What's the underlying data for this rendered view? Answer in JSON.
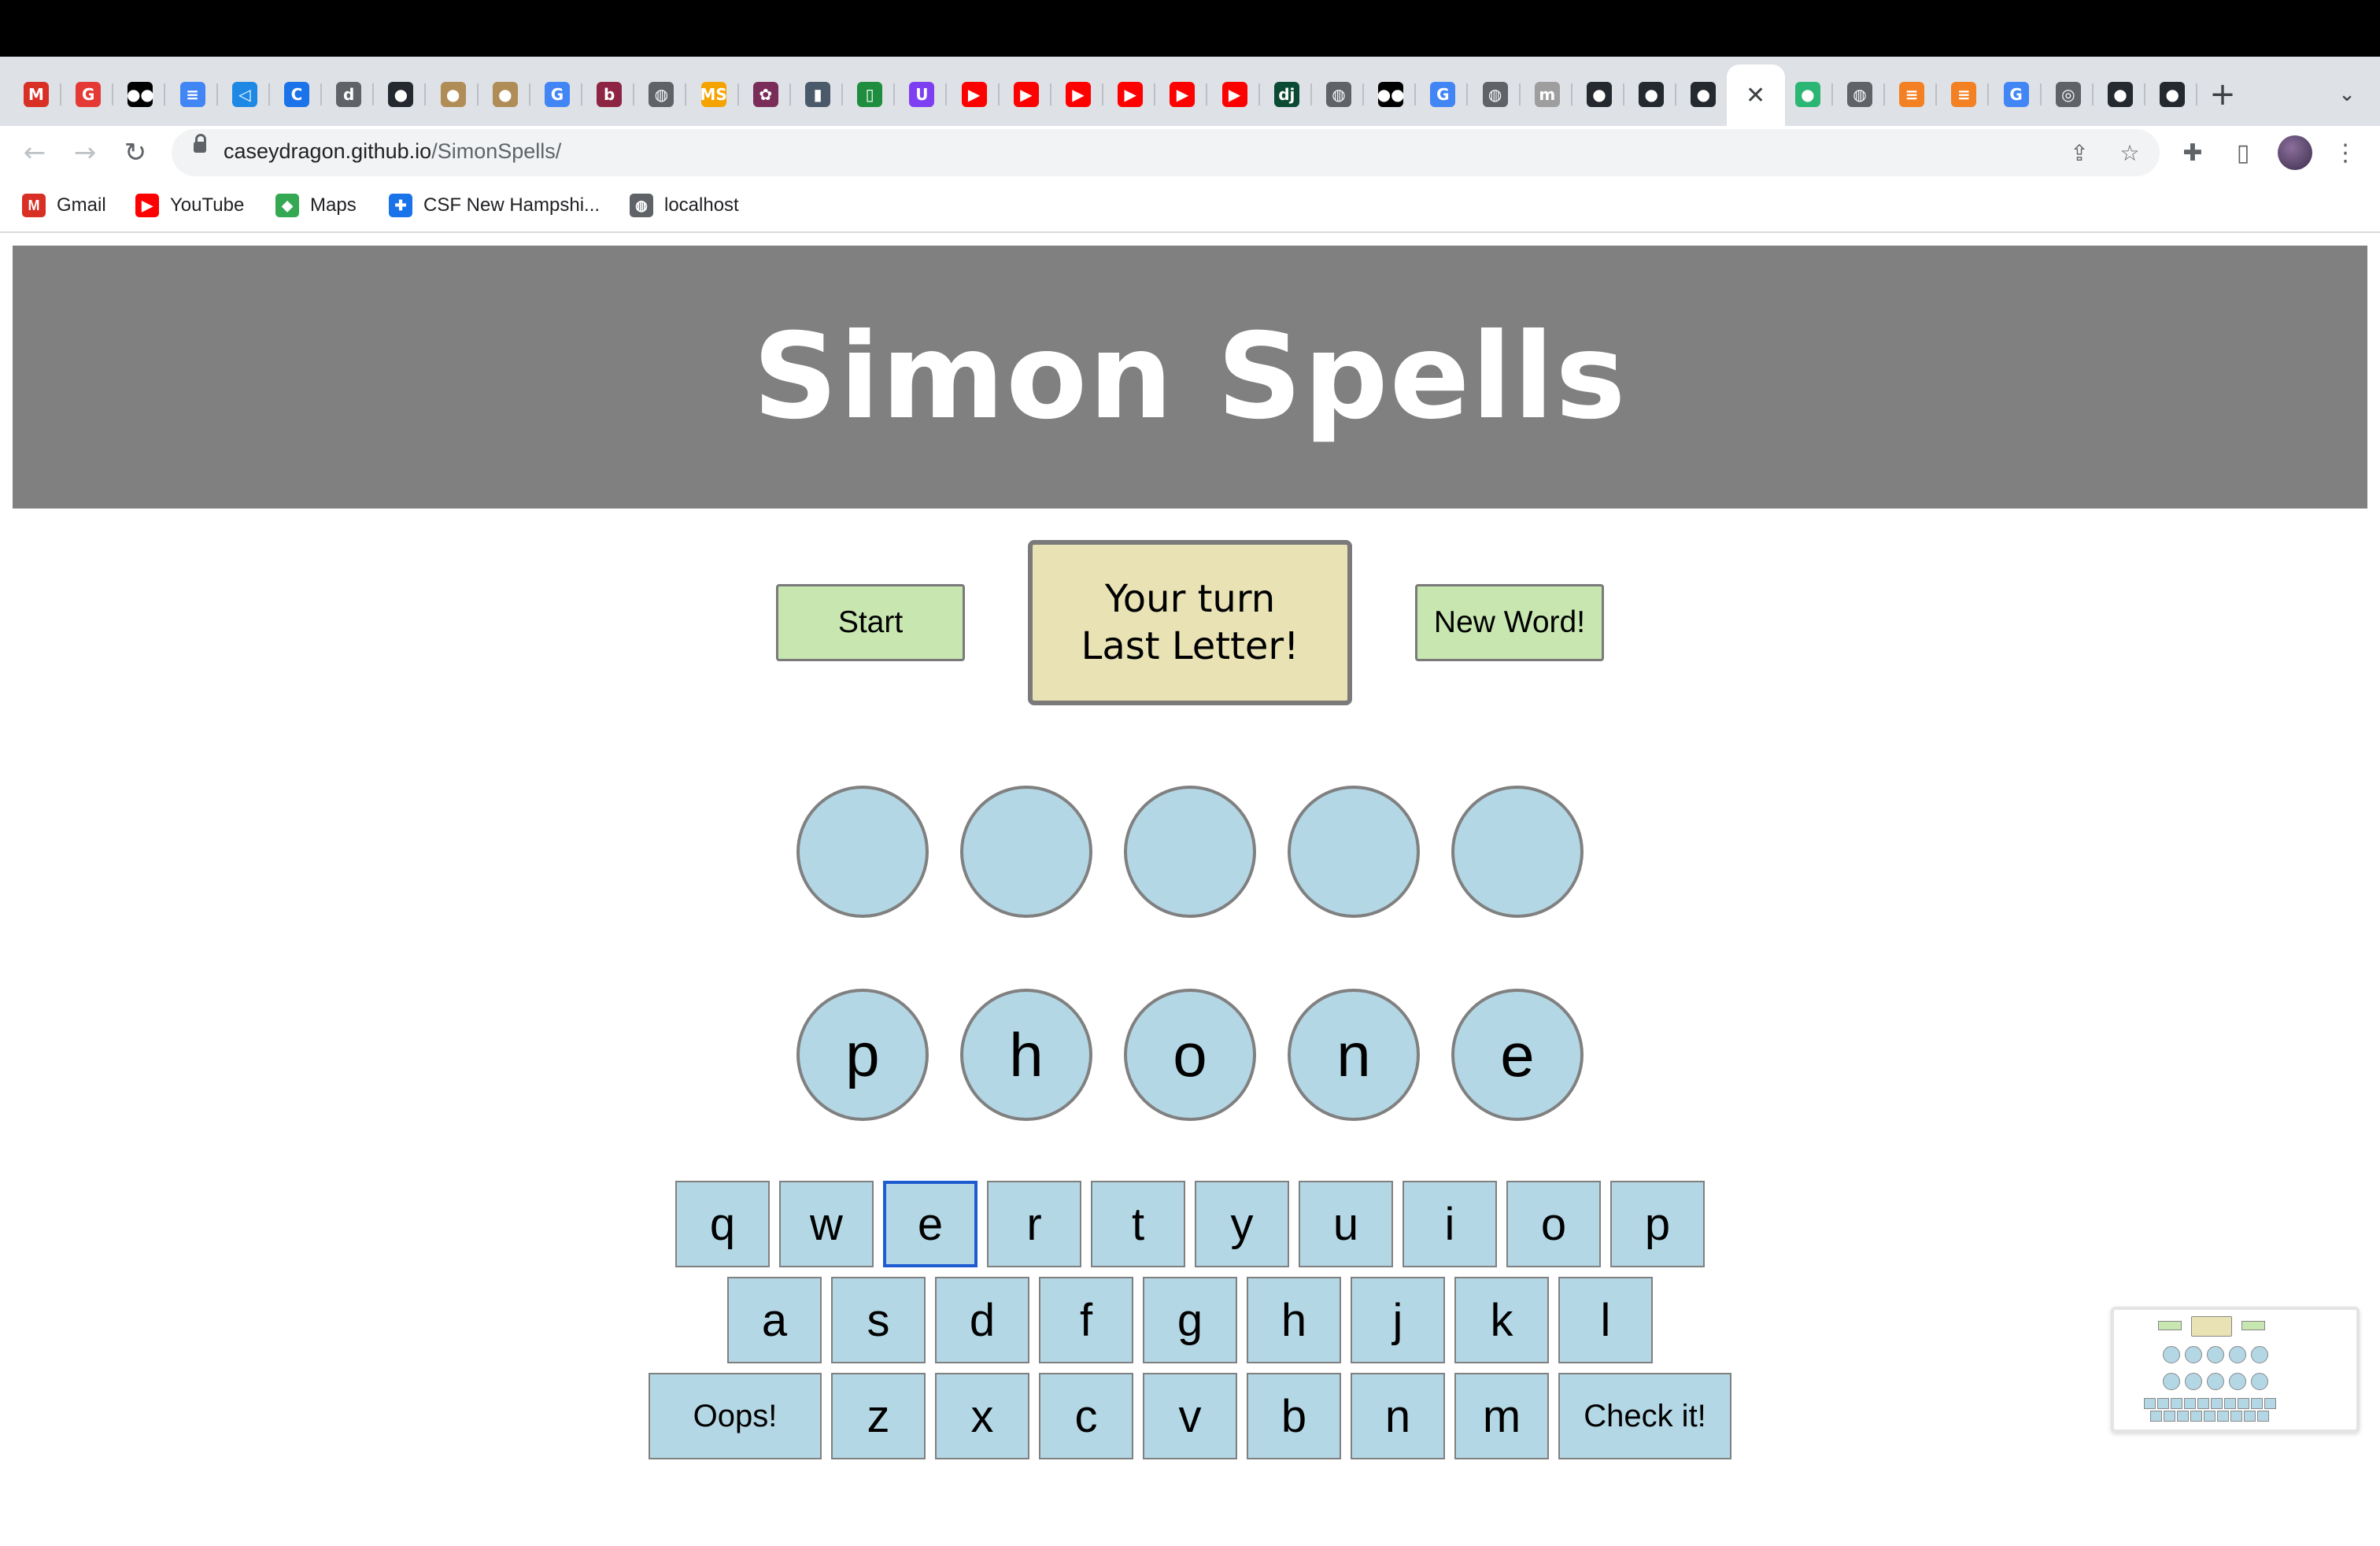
{
  "browser": {
    "tabs": [
      {
        "icon": "gmail-icon",
        "color": "#d93025",
        "glyph": "M"
      },
      {
        "icon": "ga-icon",
        "color": "#e53935",
        "glyph": "G"
      },
      {
        "icon": "medium-icon",
        "color": "#000000",
        "glyph": "●●"
      },
      {
        "icon": "docs-icon",
        "color": "#4285f4",
        "glyph": "≡"
      },
      {
        "icon": "vscode-icon",
        "color": "#1e88e5",
        "glyph": "◁"
      },
      {
        "icon": "c-icon",
        "color": "#1a73e8",
        "glyph": "C"
      },
      {
        "icon": "doc-icon",
        "color": "#5f6368",
        "glyph": "d"
      },
      {
        "icon": "github-icon",
        "color": "#24292f",
        "glyph": "●"
      },
      {
        "icon": "globe-gold-icon",
        "color": "#b08d57",
        "glyph": "●"
      },
      {
        "icon": "globe-gold-icon",
        "color": "#b08d57",
        "glyph": "●"
      },
      {
        "icon": "google-icon",
        "color": "#4285f4",
        "glyph": "G"
      },
      {
        "icon": "b-icon",
        "color": "#8e2443",
        "glyph": "b"
      },
      {
        "icon": "globe-icon",
        "color": "#5f6368",
        "glyph": "◍"
      },
      {
        "icon": "ms-icon",
        "color": "#f4a300",
        "glyph": "MS"
      },
      {
        "icon": "leaf-icon",
        "color": "#7b2d5a",
        "glyph": "✿"
      },
      {
        "icon": "bookmark-icon",
        "color": "#4a5a6a",
        "glyph": "▮"
      },
      {
        "icon": "phone-icon",
        "color": "#1e8e3e",
        "glyph": "▯"
      },
      {
        "icon": "u-icon",
        "color": "#7e3ff2",
        "glyph": "U"
      },
      {
        "icon": "youtube-icon",
        "color": "#ff0000",
        "glyph": "▶"
      },
      {
        "icon": "youtube-icon",
        "color": "#ff0000",
        "glyph": "▶"
      },
      {
        "icon": "youtube-icon",
        "color": "#ff0000",
        "glyph": "▶"
      },
      {
        "icon": "youtube-icon",
        "color": "#ff0000",
        "glyph": "▶"
      },
      {
        "icon": "youtube-icon",
        "color": "#ff0000",
        "glyph": "▶"
      },
      {
        "icon": "youtube-icon",
        "color": "#ff0000",
        "glyph": "▶"
      },
      {
        "icon": "dj-icon",
        "color": "#0c4b33",
        "glyph": "dj"
      },
      {
        "icon": "globe-icon",
        "color": "#5f6368",
        "glyph": "◍"
      },
      {
        "icon": "medium-icon",
        "color": "#000000",
        "glyph": "●●"
      },
      {
        "icon": "google-icon",
        "color": "#4285f4",
        "glyph": "G"
      },
      {
        "icon": "globe-icon",
        "color": "#5f6368",
        "glyph": "◍"
      },
      {
        "icon": "mg-icon",
        "color": "#9e9e9e",
        "glyph": "m"
      },
      {
        "icon": "github-icon",
        "color": "#24292f",
        "glyph": "●"
      },
      {
        "icon": "github-icon",
        "color": "#24292f",
        "glyph": "●"
      },
      {
        "icon": "github-icon",
        "color": "#24292f",
        "glyph": "●"
      },
      {
        "icon": "close-icon",
        "color": "#ffffff",
        "glyph": "✕",
        "active": true
      },
      {
        "icon": "leaf-green-icon",
        "color": "#2bb673",
        "glyph": "●"
      },
      {
        "icon": "globe-icon",
        "color": "#5f6368",
        "glyph": "◍"
      },
      {
        "icon": "stackoverflow-icon",
        "color": "#f48024",
        "glyph": "≡"
      },
      {
        "icon": "stackoverflow-icon",
        "color": "#f48024",
        "glyph": "≡"
      },
      {
        "icon": "google-icon",
        "color": "#4285f4",
        "glyph": "G"
      },
      {
        "icon": "chrome-icon",
        "color": "#5f6368",
        "glyph": "◎"
      },
      {
        "icon": "github-icon",
        "color": "#24292f",
        "glyph": "●"
      },
      {
        "icon": "github-icon",
        "color": "#24292f",
        "glyph": "●"
      }
    ],
    "url_host": "caseydragon.github.io",
    "url_path": "/SimonSpells/",
    "bookmarks": [
      {
        "label": "Gmail",
        "icon": "gmail-icon",
        "color": "#d93025",
        "glyph": "M"
      },
      {
        "label": "YouTube",
        "icon": "youtube-icon",
        "color": "#ff0000",
        "glyph": "▶"
      },
      {
        "label": "Maps",
        "icon": "maps-icon",
        "color": "#34a853",
        "glyph": "◆"
      },
      {
        "label": "CSF New Hampshi...",
        "icon": "puzzle-icon",
        "color": "#1a73e8",
        "glyph": "✚"
      },
      {
        "label": "localhost",
        "icon": "globe-icon",
        "color": "#5f6368",
        "glyph": "◍"
      }
    ]
  },
  "game": {
    "title": "Simon Spells",
    "start_label": "Start",
    "new_word_label": "New Word!",
    "status_line1": "Your turn",
    "status_line2": "Last Letter!",
    "target_slots": [
      "",
      "",
      "",
      "",
      ""
    ],
    "word_letters": [
      "p",
      "h",
      "o",
      "n",
      "e"
    ],
    "keyboard": {
      "row1": [
        "q",
        "w",
        "e",
        "r",
        "t",
        "y",
        "u",
        "i",
        "o",
        "p"
      ],
      "row2": [
        "a",
        "s",
        "d",
        "f",
        "g",
        "h",
        "j",
        "k",
        "l"
      ],
      "oops_label": "Oops!",
      "row3": [
        "z",
        "x",
        "c",
        "v",
        "b",
        "n",
        "m"
      ],
      "check_label": "Check it!",
      "focused_key": "e"
    },
    "colors": {
      "header": "#808080",
      "green_button": "#c8e6b0",
      "status_box": "#e8e2b4",
      "circle": "#b4d7e5",
      "key": "#b4d7e5",
      "focus_ring": "#1e5bd1"
    }
  }
}
